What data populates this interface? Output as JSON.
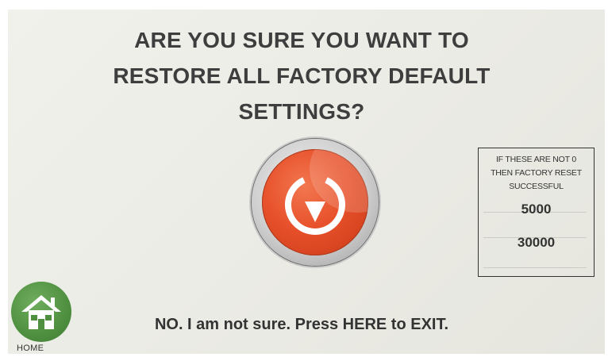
{
  "prompt": {
    "lines": [
      "ARE YOU SURE YOU WANT TO",
      "RESTORE ALL FACTORY DEFAULT",
      "SETTINGS?"
    ]
  },
  "reset_button": {
    "icon": "restore-arrow-icon",
    "color": "#e7512b"
  },
  "info_panel": {
    "caption_lines": [
      "IF THESE ARE NOT 0",
      "THEN FACTORY RESET",
      "SUCCESSFUL"
    ],
    "values": [
      "5000",
      "30000"
    ]
  },
  "home": {
    "icon": "house-icon",
    "label": "HOME",
    "color": "#4f9040"
  },
  "exit": {
    "label": "NO. I am not sure. Press HERE to EXIT."
  }
}
